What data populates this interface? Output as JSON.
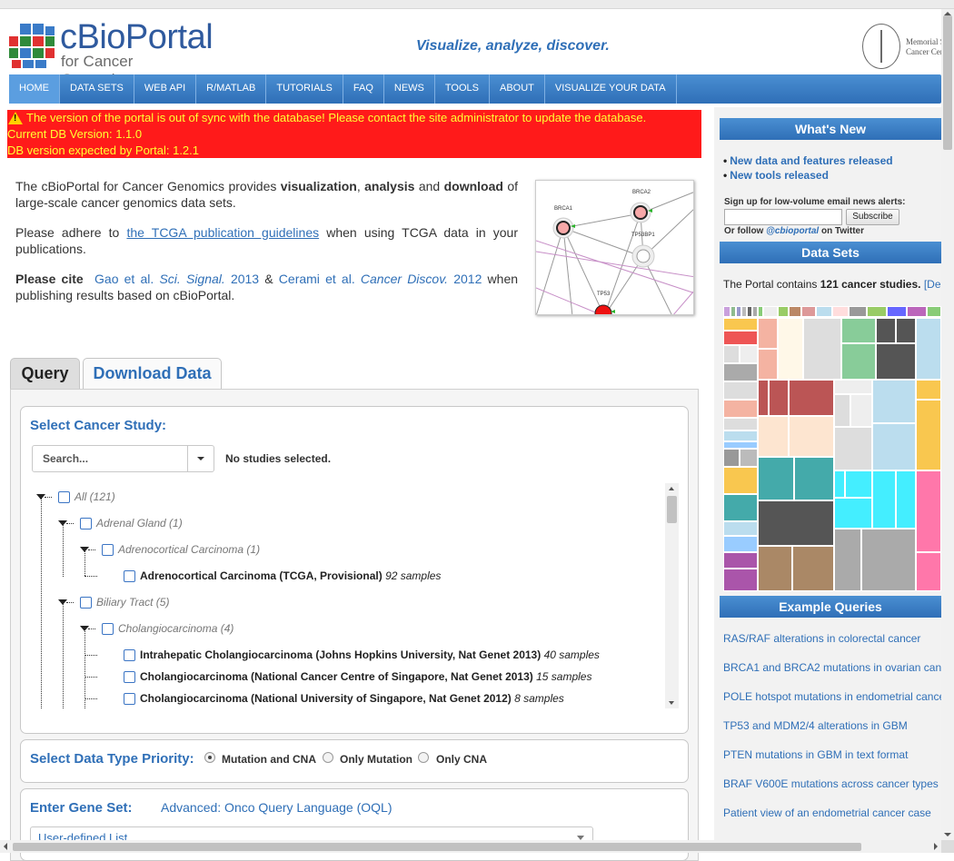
{
  "header": {
    "logo_name": "cBioPortal",
    "logo_sub": "for Cancer Genomics",
    "tagline": "Visualize, analyze, discover.",
    "partner_line1": "Memorial Sloan Kettering",
    "partner_line2": "Cancer Center"
  },
  "nav": {
    "items": [
      "HOME",
      "DATA SETS",
      "WEB API",
      "R/MATLAB",
      "TUTORIALS",
      "FAQ",
      "NEWS",
      "TOOLS",
      "ABOUT",
      "VISUALIZE YOUR DATA"
    ],
    "active": "HOME"
  },
  "warning": {
    "line1": "The version of the portal is out of sync with the database! Please contact the site administrator to update the database.",
    "line2": "Current DB Version: 1.1.0",
    "line3": "DB version expected by Portal: 1.2.1"
  },
  "intro": {
    "p1_pre": "The cBioPortal for Cancer Genomics provides ",
    "p1_b1": "visualization",
    "p1_c1": ", ",
    "p1_b2": "analysis",
    "p1_and": " and ",
    "p1_b3": "download",
    "p1_post": " of large-scale cancer genomics data sets.",
    "p2_pre": "Please adhere to ",
    "p2_link": "the TCGA publication guidelines",
    "p2_post": " when using TCGA data in your publications.",
    "p3_b": "Please cite",
    "p3_link1a": "Gao et al. ",
    "p3_link1b": "Sci. Signal.",
    "p3_link1c": " 2013",
    "p3_amp": " & ",
    "p3_link2a": "Cerami et al. ",
    "p3_link2b": "Cancer Discov.",
    "p3_link2c": " 2012",
    "p3_post": " when publishing results based on cBioPortal."
  },
  "network": {
    "labels": [
      "BRCA1",
      "BRCA2",
      "TP53BP1",
      "TP53"
    ]
  },
  "tabs": {
    "query": "Query",
    "download": "Download Data"
  },
  "study": {
    "title": "Select Cancer Study:",
    "search_placeholder": "Search...",
    "no_selection": "No studies selected.",
    "tree": [
      {
        "label": "All (121)",
        "kind": "group",
        "level": 0
      },
      {
        "label": "Adrenal Gland (1)",
        "kind": "group",
        "level": 1
      },
      {
        "label": "Adrenocortical Carcinoma (1)",
        "kind": "group",
        "level": 2
      },
      {
        "label": "Adrenocortical Carcinoma (TCGA, Provisional)",
        "samples": "92 samples",
        "kind": "study",
        "level": 3
      },
      {
        "label": "Biliary Tract (5)",
        "kind": "group",
        "level": 1
      },
      {
        "label": "Cholangiocarcinoma (4)",
        "kind": "group",
        "level": 2
      },
      {
        "label": "Intrahepatic Cholangiocarcinoma (Johns Hopkins University, Nat Genet 2013)",
        "samples": "40 samples",
        "kind": "study",
        "level": 3
      },
      {
        "label": "Cholangiocarcinoma (National Cancer Centre of Singapore, Nat Genet 2013)",
        "samples": "15 samples",
        "kind": "study",
        "level": 3
      },
      {
        "label": "Cholangiocarcinoma (National University of Singapore, Nat Genet 2012)",
        "samples": "8 samples",
        "kind": "study",
        "level": 3
      }
    ]
  },
  "data_type": {
    "title": "Select Data Type Priority:",
    "options": [
      "Mutation and CNA",
      "Only Mutation",
      "Only CNA"
    ],
    "selected": "Mutation and CNA"
  },
  "gene_set": {
    "title": "Enter Gene Set:",
    "oql_link": "Advanced: Onco Query Language (OQL)",
    "select_value": "User-defined List"
  },
  "sidebar": {
    "whats_new_title": "What's New",
    "news": [
      "New data and features released",
      "New tools released"
    ],
    "signup_text": "Sign up for low-volume email news alerts:",
    "subscribe_label": "Subscribe",
    "follow_pre": "Or follow ",
    "follow_handle": "@cbioportal",
    "follow_post": " on Twitter",
    "data_sets_title": "Data Sets",
    "portal_pre": "The Portal contains ",
    "portal_count": "121 cancer studies.",
    "portal_link": "[De",
    "example_title": "Example Queries",
    "examples": [
      "RAS/RAF alterations in colorectal cancer",
      "BRCA1 and BRCA2 mutations in ovarian can",
      "POLE hotspot mutations in endometrial cance",
      "TP53 and MDM2/4 alterations in GBM",
      "PTEN mutations in GBM in text format",
      "BRAF V600E mutations across cancer types",
      "Patient view of an endometrial cancer case"
    ]
  },
  "colors": {
    "brand_blue": "#2f6fb7",
    "warning_bg": "#ff1a1a",
    "warning_text": "#ffff33"
  }
}
